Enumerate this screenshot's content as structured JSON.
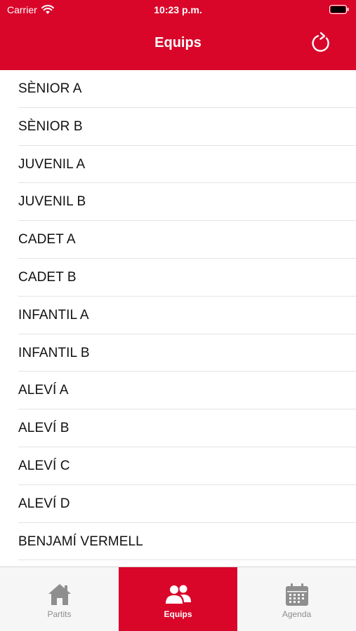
{
  "status_bar": {
    "carrier": "Carrier",
    "time": "10:23 p.m.",
    "icons": [
      "wifi-icon",
      "battery-icon"
    ]
  },
  "nav": {
    "title": "Equips",
    "refresh_icon": "refresh-icon"
  },
  "colors": {
    "brand_red": "#d9062a",
    "text": "#111111",
    "separator": "#e3e3e3",
    "tab_inactive": "#8e8e8e",
    "tabbar_bg": "#f6f6f6"
  },
  "teams": [
    "SÈNIOR A",
    "SÈNIOR B",
    "JUVENIL A",
    "JUVENIL B",
    "CADET A",
    "CADET B",
    "INFANTIL A",
    "INFANTIL B",
    "ALEVÍ A",
    "ALEVÍ B",
    "ALEVÍ C",
    "ALEVÍ D",
    "BENJAMÍ VERMELL"
  ],
  "tabs": [
    {
      "label": "Partits",
      "icon": "home-icon",
      "active": false
    },
    {
      "label": "Equips",
      "icon": "people-icon",
      "active": true
    },
    {
      "label": "Agenda",
      "icon": "calendar-icon",
      "active": false
    }
  ]
}
